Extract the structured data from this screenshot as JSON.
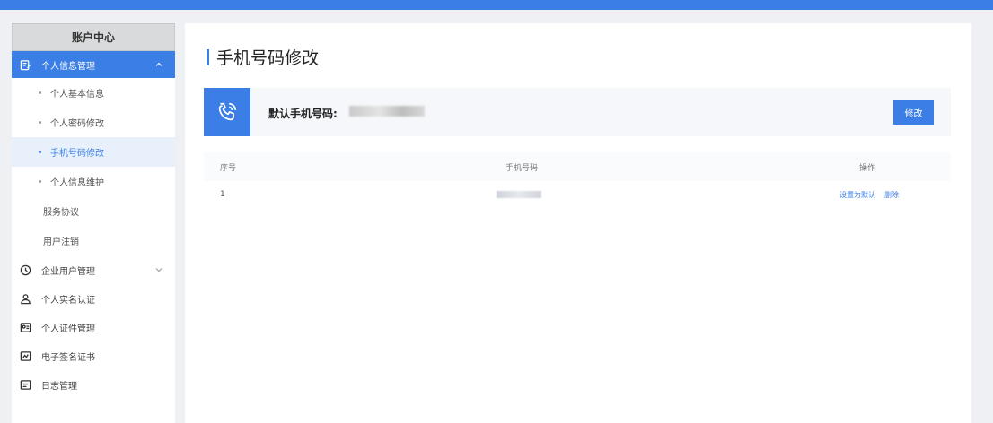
{
  "sidebar": {
    "header": "账户中心",
    "group": {
      "label": "个人信息管理",
      "icon": "edit-icon"
    },
    "sub_items": [
      {
        "label": "个人基本信息"
      },
      {
        "label": "个人密码修改"
      },
      {
        "label": "手机号码修改"
      },
      {
        "label": "个人信息维护"
      },
      {
        "label": "服务协议"
      },
      {
        "label": "用户注销"
      }
    ],
    "items": [
      {
        "label": "企业用户管理",
        "icon": "clock-icon"
      },
      {
        "label": "个人实名认证",
        "icon": "user-icon"
      },
      {
        "label": "个人证件管理",
        "icon": "id-card-icon"
      },
      {
        "label": "电子签名证书",
        "icon": "certificate-icon"
      },
      {
        "label": "日志管理",
        "icon": "log-icon"
      }
    ]
  },
  "main": {
    "title": "手机号码修改",
    "phone_card": {
      "label": "默认手机号码:",
      "value": "",
      "button": "修改",
      "icon": "phone-icon"
    },
    "table": {
      "columns": [
        "序号",
        "手机号码",
        "操作"
      ],
      "rows": [
        {
          "index": "1",
          "phone": "",
          "actions": [
            "设置为默认",
            "删除"
          ]
        }
      ]
    }
  },
  "colors": {
    "accent": "#3b7fe6",
    "sidebar_header_bg": "#d9dadc",
    "card_bg": "#f5f7fa",
    "page_bg": "#eef0f3"
  }
}
